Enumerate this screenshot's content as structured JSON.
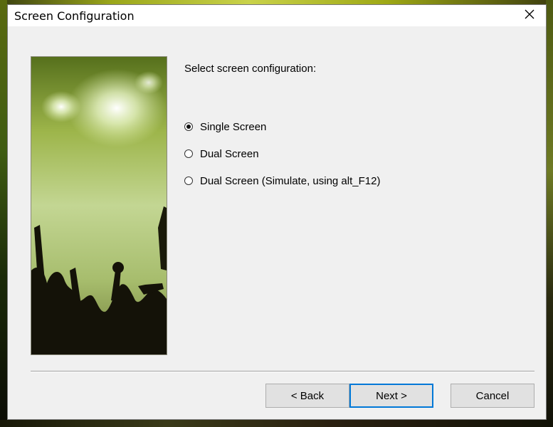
{
  "window": {
    "title": "Screen Configuration",
    "close_glyph": "✕"
  },
  "prompt": "Select screen configuration:",
  "options": [
    {
      "label": "Single Screen",
      "selected": true
    },
    {
      "label": "Dual Screen",
      "selected": false
    },
    {
      "label": "Dual Screen (Simulate, using alt_F12)",
      "selected": false
    }
  ],
  "buttons": {
    "back": "< Back",
    "next": "Next >",
    "cancel": "Cancel"
  },
  "colors": {
    "accent": "#0078d7",
    "dialog_bg": "#f0f0f0",
    "image_tint": "#b5c97a"
  },
  "icons": [
    "close-icon",
    "concert-image"
  ]
}
